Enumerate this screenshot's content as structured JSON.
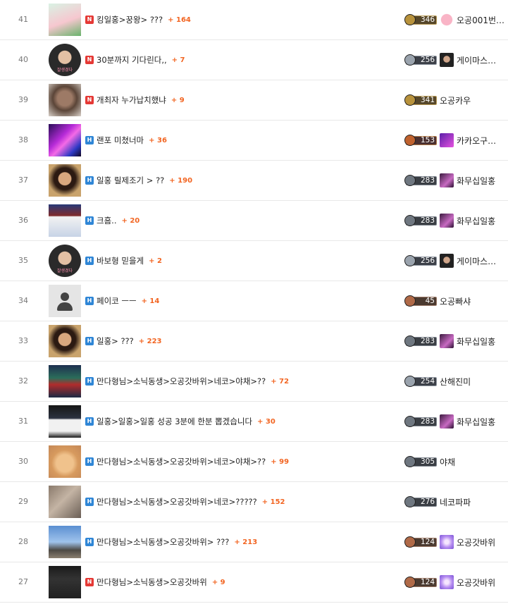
{
  "posts": [
    {
      "num": "41",
      "badge": "N",
      "title": "킹일홍>꿍왕> ???",
      "comments": "+ 164",
      "level": "346",
      "level_style": "gold",
      "user": "오공001번…",
      "thumb": "pig",
      "avatar": "pig"
    },
    {
      "num": "40",
      "badge": "N",
      "title": "30분까지 기다린다,,",
      "comments": "+ 7",
      "level": "256",
      "level_style": "silver",
      "user": "게이마스…",
      "thumb": "face-round",
      "thumb_caption": "잘생겼다",
      "avatar": "face"
    },
    {
      "num": "39",
      "badge": "N",
      "title": "개최자 누가납치했냐",
      "comments": "+ 9",
      "level": "341",
      "level_style": "gold",
      "user": "오공카우",
      "thumb": "dog"
    },
    {
      "num": "38",
      "badge": "H",
      "title": "랜포 미쳤너마",
      "comments": "+ 36",
      "level": "153",
      "level_style": "red",
      "user": "카카오구…",
      "thumb": "neon",
      "avatar": "neon"
    },
    {
      "num": "37",
      "badge": "H",
      "title": "일홍 릴제조기 > ??",
      "comments": "+ 190",
      "level": "283",
      "level_style": "steel",
      "user": "화무십일홍",
      "thumb": "man",
      "avatar": "purple"
    },
    {
      "num": "36",
      "badge": "H",
      "title": "크흠..",
      "comments": "+ 20",
      "level": "283",
      "level_style": "steel",
      "user": "화무십일홍",
      "thumb": "game",
      "avatar": "purple"
    },
    {
      "num": "35",
      "badge": "H",
      "title": "바보형 믿을게",
      "comments": "+ 2",
      "level": "256",
      "level_style": "silver",
      "user": "게이마스…",
      "thumb": "face-round",
      "thumb_caption": "잘생겼다",
      "avatar": "face"
    },
    {
      "num": "34",
      "badge": "H",
      "title": "페이코 ㅡㅡ",
      "comments": "+ 14",
      "level": "45",
      "level_style": "bronze",
      "user": "오공빠샤",
      "thumb": "person"
    },
    {
      "num": "33",
      "badge": "H",
      "title": "일홍> ???",
      "comments": "+ 223",
      "level": "283",
      "level_style": "steel",
      "user": "화무십일홍",
      "thumb": "man",
      "avatar": "purple"
    },
    {
      "num": "32",
      "badge": "H",
      "title": "만다형님>소닉동생>오공갓바위>네코>야채>??",
      "comments": "+ 72",
      "level": "254",
      "level_style": "silver",
      "user": "산해진미",
      "thumb": "game2"
    },
    {
      "num": "31",
      "badge": "H",
      "title": "일홍>일홍>일홍 성공 3분에 한분 뽑겠습니다",
      "comments": "+ 30",
      "level": "283",
      "level_style": "steel",
      "user": "화무십일홍",
      "thumb": "screen",
      "avatar": "purple"
    },
    {
      "num": "30",
      "badge": "H",
      "title": "만다형님>소닉동생>오공갓바위>네코>야채>??",
      "comments": "+ 99",
      "level": "305",
      "level_style": "steel",
      "user": "야채",
      "thumb": "cat"
    },
    {
      "num": "29",
      "badge": "H",
      "title": "만다형님>소닉동생>오공갓바위>네코>?????",
      "comments": "+ 152",
      "level": "276",
      "level_style": "steel",
      "user": "네코파파",
      "thumb": "sleep"
    },
    {
      "num": "28",
      "badge": "H",
      "title": "만다형님>소닉동생>오공갓바위> ???",
      "comments": "+ 213",
      "level": "124",
      "level_style": "bronze",
      "user": "오공갓바위",
      "thumb": "sky",
      "avatar": "orb"
    },
    {
      "num": "27",
      "badge": "N",
      "title": "만다형님>소닉동생>오공갓바위",
      "comments": "+ 9",
      "level": "124",
      "level_style": "bronze",
      "user": "오공갓바위",
      "thumb": "dark",
      "avatar": "orb"
    }
  ]
}
